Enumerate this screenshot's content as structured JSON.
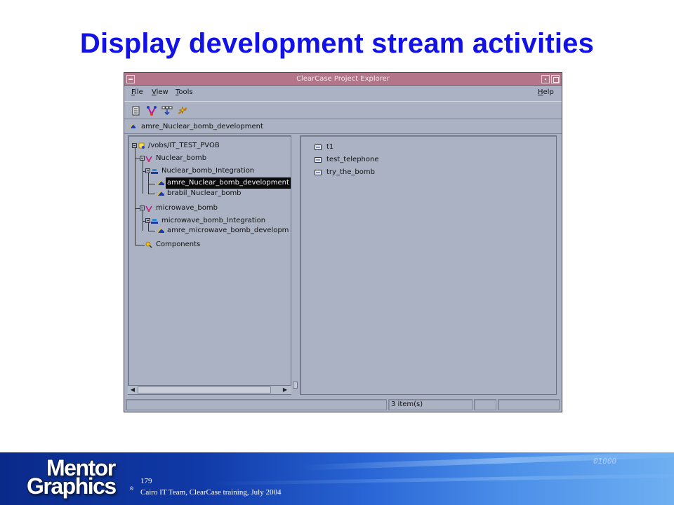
{
  "slide": {
    "title": "Display development stream activities",
    "page_number": "179",
    "footer_text": "Cairo IT Team, ClearCase training, July 2004",
    "footer_deco_text": "01000",
    "logo": {
      "line1": "Mentor",
      "line2": "Graphics",
      "reg_mark": "®"
    }
  },
  "window": {
    "title": "ClearCase Project Explorer",
    "menu": [
      "File",
      "View",
      "Tools"
    ],
    "help_menu": "Help",
    "toolbar_icons": [
      "properties-icon",
      "hierarchy-icon",
      "merge-icon",
      "deliver-icon"
    ],
    "current_path": "amre_Nuclear_bomb_development"
  },
  "tree": {
    "root": "/vobs/IT_TEST_PVOB",
    "project1": "Nuclear_bomb",
    "project1_integration": "Nuclear_bomb_Integration",
    "project1_dev_selected": "amre_Nuclear_bomb_development",
    "project1_dev2": "brabil_Nuclear_bomb",
    "project2": "microwave_bomb",
    "project2_integration": "microwave_bomb_Integration",
    "project2_dev": "amre_microwave_bomb_developm",
    "components": "Components"
  },
  "activities": [
    "t1",
    "test_telephone",
    "try_the_bomb"
  ],
  "status": {
    "item_count": "3 item(s)"
  },
  "colors": {
    "title_blue": "#1212e6",
    "window_bg": "#aab2c3",
    "titlebar": "#b27589",
    "selection": "#0a0a0a"
  }
}
